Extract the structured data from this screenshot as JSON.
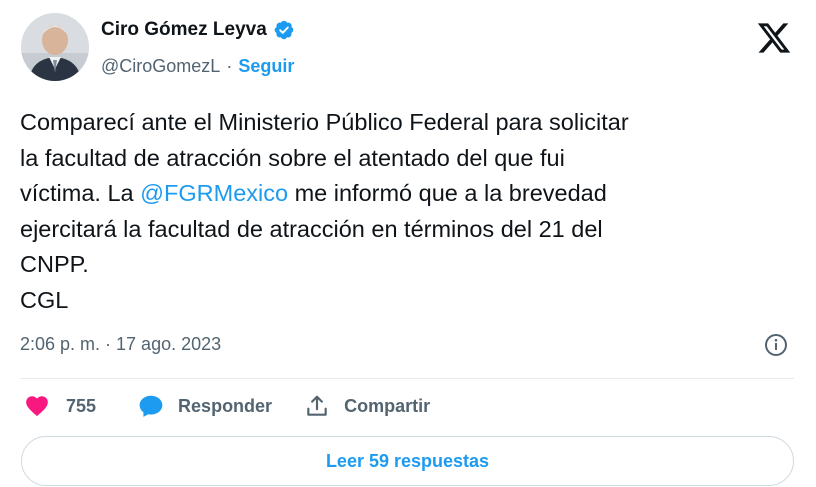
{
  "author": {
    "name": "Ciro Gómez Leyva",
    "handle": "@CiroGomezL",
    "separator": "·",
    "follow_label": "Seguir",
    "verified": true
  },
  "tweet": {
    "text_before_mention": "Comparecí ante el Ministerio Público Federal para solicitar\nla facultad de atracción sobre el atentado del que fui\nvíctima. La ",
    "mention": "@FGRMexico",
    "text_after_mention": " me informó que a la brevedad\nejercitará la facultad de atracción en términos del 21 del\nCNPP.\nCGL"
  },
  "meta": {
    "timestamp": "2:06 p. m. · 17 ago. 2023"
  },
  "actions": {
    "likes_count": "755",
    "reply_label": "Responder",
    "share_label": "Compartir"
  },
  "replies_button": {
    "label": "Leer 59 respuestas"
  },
  "colors": {
    "accent": "#1d9bf0",
    "secondary_text": "#536471",
    "heart": "#f91880"
  },
  "icons": [
    "verified-badge-icon",
    "x-logo-icon",
    "info-icon",
    "heart-icon",
    "reply-bubble-icon",
    "share-icon"
  ]
}
